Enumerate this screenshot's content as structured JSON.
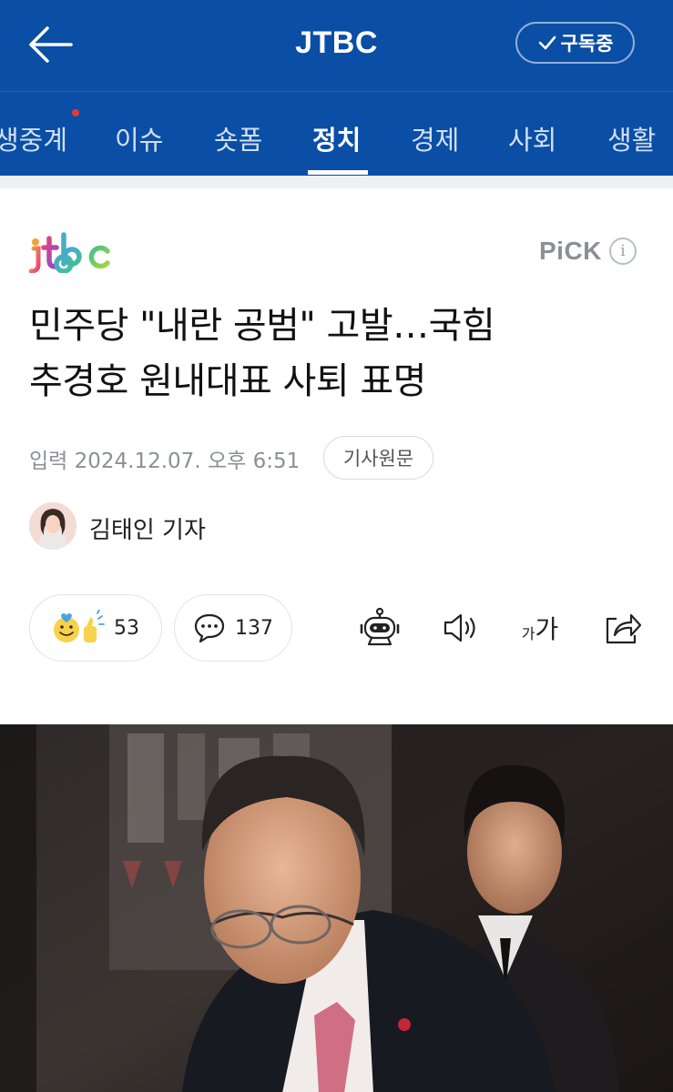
{
  "header": {
    "brand": "JTBC",
    "subscribe_label": "구독중"
  },
  "tabs": [
    {
      "label": "생중계"
    },
    {
      "label": "이슈"
    },
    {
      "label": "숏폼"
    },
    {
      "label": "정치"
    },
    {
      "label": "경제"
    },
    {
      "label": "사회"
    },
    {
      "label": "생활"
    }
  ],
  "active_tab": "정치",
  "article": {
    "publisher_logo": "jtbc",
    "pick_label": "PiCK",
    "headline_line1": "민주당 \"내란 공범\" 고발…국힘",
    "headline_line2": "추경호 원내대표 사퇴 표명",
    "date_text": "입력 2024.12.07. 오후 6:51",
    "original_label": "기사원문",
    "reporter": "김태인 기자"
  },
  "actions": {
    "reactions_count": "53",
    "comments_count": "137",
    "font_size_small": "가",
    "font_size_large": "가"
  },
  "colors": {
    "header_bg": "#0a4ea6",
    "new_dot": "#e53935"
  },
  "icons": [
    "back-arrow-icon",
    "check-icon",
    "info-icon",
    "smiley-thumbs-icon",
    "comment-icon",
    "robot-icon",
    "speaker-icon",
    "text-size-icon",
    "share-icon"
  ]
}
